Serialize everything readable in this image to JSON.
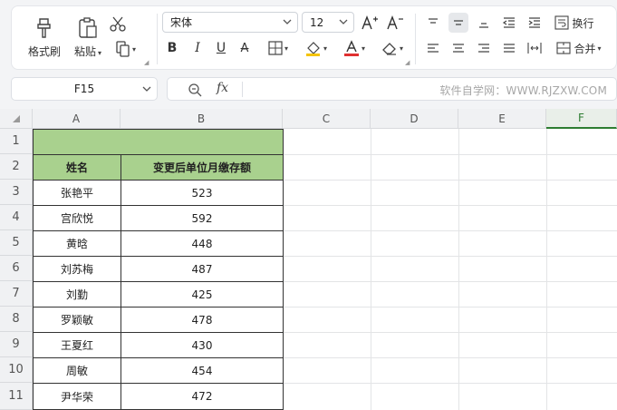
{
  "ribbon": {
    "format_painter": "格式刷",
    "paste": "粘贴",
    "font_name": "宋体",
    "font_size": "12",
    "wrap": "换行",
    "merge": "合并"
  },
  "formula_bar": {
    "cell_ref": "F15",
    "fx": "fx",
    "watermark": "软件自学网：WWW.RJZXW.COM"
  },
  "columns": [
    "A",
    "B",
    "C",
    "D",
    "E",
    "F"
  ],
  "rows": [
    "1",
    "2",
    "3",
    "4",
    "5",
    "6",
    "7",
    "8",
    "9",
    "10",
    "11"
  ],
  "table": {
    "header": [
      "姓名",
      "变更后单位月缴存额"
    ],
    "data": [
      [
        "张艳平",
        "523"
      ],
      [
        "宫欣悦",
        "592"
      ],
      [
        "黄晗",
        "448"
      ],
      [
        "刘苏梅",
        "487"
      ],
      [
        "刘勤",
        "425"
      ],
      [
        "罗颖敏",
        "478"
      ],
      [
        "王夏红",
        "430"
      ],
      [
        "周敏",
        "454"
      ],
      [
        "尹华荣",
        "472"
      ]
    ]
  },
  "colors": {
    "header_fill": "#a9d18e",
    "selected_col": "#2e7d32",
    "font_color_bar": "#e03030",
    "fill_color_bar": "#f5c400"
  }
}
